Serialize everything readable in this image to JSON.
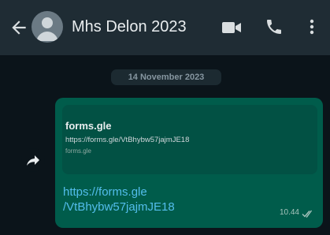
{
  "header": {
    "title": "Mhs Delon 2023",
    "back_icon": "arrow-left-icon",
    "avatar_icon": "default-avatar-icon",
    "video_icon": "video-camera-icon",
    "call_icon": "phone-icon",
    "menu_icon": "more-vertical-icon"
  },
  "chat": {
    "date_chip": "14 November 2023",
    "message": {
      "preview_title": "forms.gle",
      "preview_url": "https://forms.gle/VtBhybw57jajmJE18",
      "preview_domain": "forms.gle",
      "link_line1": "https://forms.gle",
      "link_line2": "/VtBhybw57jajmJE18",
      "time": "10.44",
      "status_icon": "double-check-icon",
      "forward_icon": "forward-icon"
    }
  },
  "colors": {
    "header_bg": "#1f2c34",
    "chat_bg": "#0b141a",
    "bubble_bg": "#005c4b",
    "link": "#53bdeb"
  }
}
